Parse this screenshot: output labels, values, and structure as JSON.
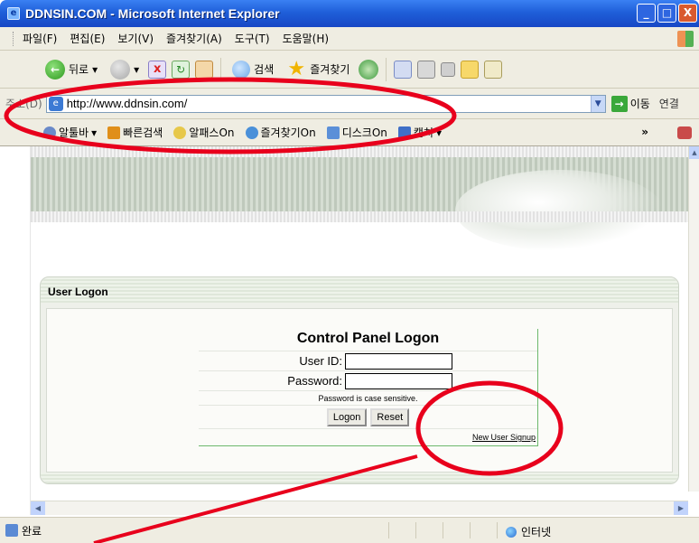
{
  "window": {
    "title": "DDNSIN.COM - Microsoft Internet Explorer",
    "controls": [
      "_",
      "□",
      "X"
    ]
  },
  "menu": {
    "items": [
      "파일(F)",
      "편집(E)",
      "보기(V)",
      "즐겨찾기(A)",
      "도구(T)",
      "도움말(H)"
    ]
  },
  "toolbar": {
    "back_label": "뒤로",
    "search_label": "검색",
    "favorites_label": "즐겨찾기"
  },
  "address": {
    "label": "주소(D)",
    "url": "http://www.ddnsin.com/",
    "go_label": "이동",
    "links_label": "연결"
  },
  "linkbar": {
    "items": [
      "알툴바",
      "빠른검색",
      "알패스On",
      "즐겨찾기On",
      "디스크On",
      "캡쳐"
    ]
  },
  "page": {
    "panel_title": "User Logon",
    "logon_title": "Control Panel Logon",
    "userid_label": "User ID:",
    "password_label": "Password:",
    "case_note": "Password is case sensitive.",
    "logon_button": "Logon",
    "reset_button": "Reset",
    "signup_link": "New User Signup"
  },
  "status": {
    "text": "완료",
    "zone": "인터넷"
  },
  "annotation_color": "#e8001c"
}
